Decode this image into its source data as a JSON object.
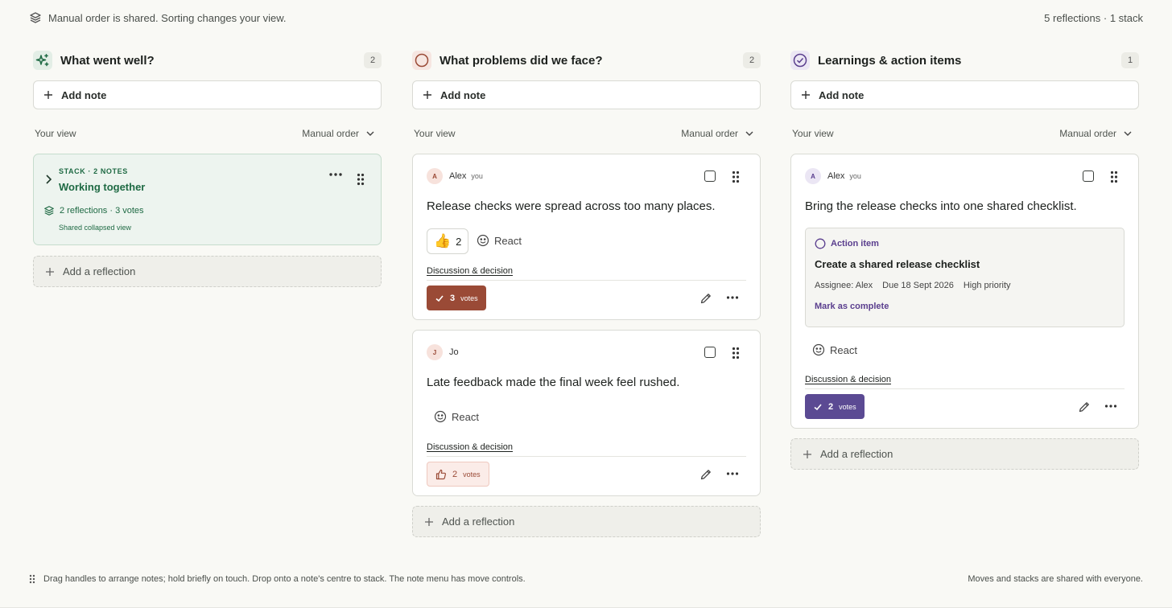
{
  "topbar": {
    "notice": "Manual order is shared. Sorting changes your view.",
    "summary": "5 reflections · 1 stack"
  },
  "columns": [
    {
      "title": "What went well?",
      "count": "2",
      "add_note": "Add note",
      "view_label": "Your view",
      "sort_label": "Manual order",
      "stack": {
        "meta": "STACK · 2 NOTES",
        "title": "Working together",
        "summary": "2 reflections · 3 votes",
        "shared": "Shared collapsed view"
      },
      "add_reflection": "Add a reflection"
    },
    {
      "title": "What problems did we face?",
      "count": "2",
      "add_note": "Add note",
      "view_label": "Your view",
      "sort_label": "Manual order",
      "notes": [
        {
          "avatar": "A",
          "author": "Alex",
          "you": "you",
          "text": "Release checks were spread across too many places.",
          "reaction_emoji": "👍",
          "reaction_count": "2",
          "react": "React",
          "discussion": "Discussion & decision",
          "votes": "3",
          "votes_unit": "votes"
        },
        {
          "avatar": "J",
          "author": "Jo",
          "text": "Late feedback made the final week feel rushed.",
          "react": "React",
          "discussion": "Discussion & decision",
          "votes": "2",
          "votes_unit": "votes"
        }
      ],
      "add_reflection": "Add a reflection"
    },
    {
      "title": "Learnings & action items",
      "count": "1",
      "add_note": "Add note",
      "view_label": "Your view",
      "sort_label": "Manual order",
      "notes": [
        {
          "avatar": "A",
          "author": "Alex",
          "you": "you",
          "text": "Bring the release checks into one shared checklist.",
          "action_item": {
            "label": "Action item",
            "title": "Create a shared release checklist",
            "assignee": "Assignee: Alex",
            "due": "Due 18 Sept 2026",
            "priority": "High priority",
            "complete": "Mark as complete"
          },
          "react": "React",
          "discussion": "Discussion & decision",
          "votes": "2",
          "votes_unit": "votes"
        }
      ],
      "add_reflection": "Add a reflection"
    }
  ],
  "footer": {
    "hint": "Drag handles to arrange notes; hold briefly on touch. Drop onto a note's centre to stack. The note menu has move controls.",
    "shared": "Moves and stacks are shared with everyone."
  },
  "colors": {
    "green": "#1f6a44",
    "red_vote": "#9a4a36",
    "purple_vote": "#5b4a93",
    "purple_text": "#5a3e8e"
  }
}
